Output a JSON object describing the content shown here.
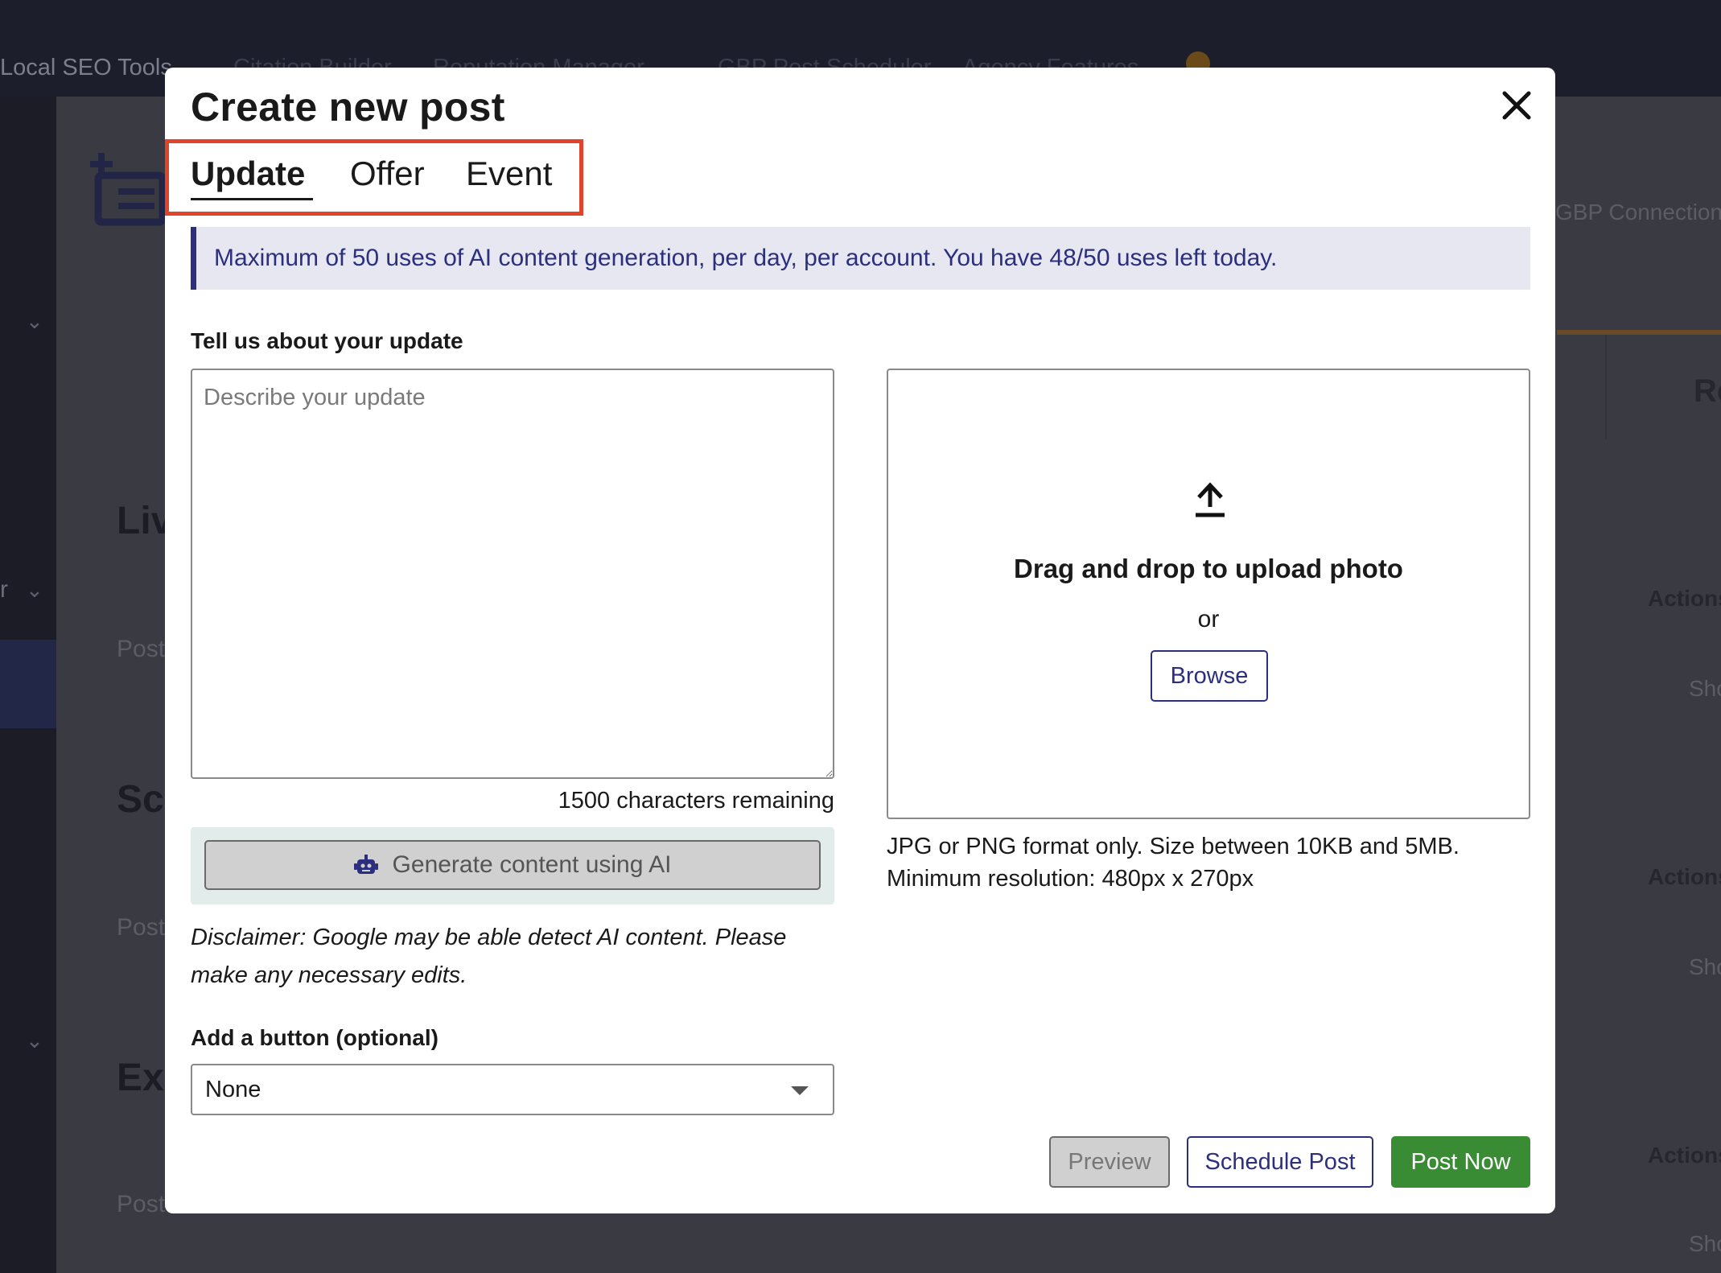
{
  "background": {
    "nav_links": [
      "Local SEO Tools",
      "Citation Builder",
      "Reputation Manager",
      "GBP Post Scheduler",
      "Agency Features"
    ],
    "right_link": "GBP Connection",
    "section_headings": [
      "Liv",
      "Sc",
      "Ex"
    ],
    "section_subtexts": [
      "Post",
      "Post",
      "Post"
    ],
    "sidebar_letter": "r",
    "right_header_partial": "Re",
    "actions_label": "Actions",
    "showing_label": "Showi"
  },
  "modal": {
    "title": "Create new post",
    "tabs": [
      {
        "label": "Update",
        "active": true
      },
      {
        "label": "Offer",
        "active": false
      },
      {
        "label": "Event",
        "active": false
      }
    ],
    "info_banner": "Maximum of 50 uses of AI content generation, per day, per account. You have 48/50 uses left today.",
    "update_label": "Tell us about your update",
    "textarea_placeholder": "Describe your update",
    "chars_remaining": "1500 characters remaining",
    "ai_button_label": "Generate content using AI",
    "disclaimer": "Disclaimer: Google may be able detect AI content. Please make any necessary edits.",
    "button_label": "Add a button (optional)",
    "button_select_value": "None",
    "upload": {
      "title": "Drag and drop to upload photo",
      "or": "or",
      "browse": "Browse",
      "format_line1": "JPG or PNG format only. Size between 10KB and 5MB.",
      "format_line2": "Minimum resolution: 480px x 270px"
    },
    "footer": {
      "preview": "Preview",
      "schedule": "Schedule Post",
      "post_now": "Post Now"
    }
  },
  "colors": {
    "accent_navy": "#2c2f7e",
    "post_now_green": "#3a8c34",
    "tab_highlight": "#e0442b"
  }
}
